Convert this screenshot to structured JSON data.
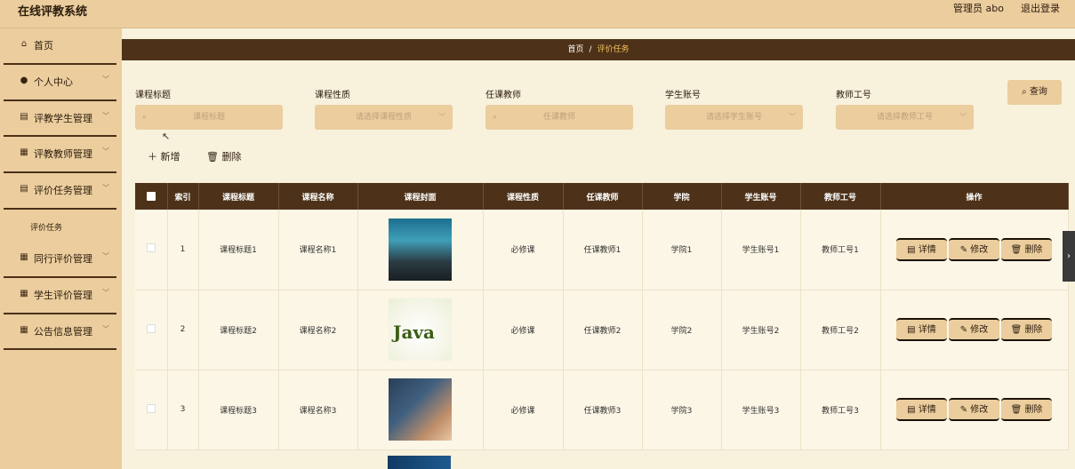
{
  "header": {
    "title": "在线评教系统",
    "user": "管理员 abo",
    "logout": "退出登录"
  },
  "sidebar": {
    "items": [
      {
        "label": "首页",
        "icon": "home-icon",
        "glyph": "⌂",
        "chevron": false
      },
      {
        "label": "个人中心",
        "icon": "user-icon",
        "glyph": "●",
        "chevron": true
      },
      {
        "label": "评教学生管理",
        "icon": "grid-icon",
        "glyph": "▤",
        "chevron": true
      },
      {
        "label": "评教教师管理",
        "icon": "apps-icon",
        "glyph": "▦",
        "chevron": true
      },
      {
        "label": "评价任务管理",
        "icon": "document-icon",
        "glyph": "▤",
        "chevron": true
      }
    ],
    "subitem": "评价任务",
    "items2": [
      {
        "label": "同行评价管理",
        "icon": "grid-icon",
        "glyph": "▦",
        "chevron": true
      },
      {
        "label": "学生评价管理",
        "icon": "apps-icon",
        "glyph": "▦",
        "chevron": true
      },
      {
        "label": "公告信息管理",
        "icon": "apps-icon",
        "glyph": "▦",
        "chevron": true
      }
    ]
  },
  "breadcrumb": {
    "home": "首页",
    "sep": "/",
    "current": "评价任务"
  },
  "search": {
    "fields": [
      {
        "label": "课程标题",
        "placeholder": "课程标题"
      },
      {
        "label": "课程性质",
        "placeholder": "请选择课程性质"
      },
      {
        "label": "任课教师",
        "placeholder": "任课教师"
      },
      {
        "label": "学生账号",
        "placeholder": "请选择学生账号"
      },
      {
        "label": "教师工号",
        "placeholder": "请选择教师工号"
      }
    ],
    "query": "查询"
  },
  "actions": {
    "add": "新增",
    "delete": "删除"
  },
  "table": {
    "headers": [
      "索引",
      "课程标题",
      "课程名称",
      "课程封面",
      "课程性质",
      "任课教师",
      "学院",
      "学生账号",
      "教师工号",
      "操作"
    ],
    "rows": [
      {
        "index": "1",
        "title": "课程标题1",
        "name": "课程名称1",
        "nature": "必修课",
        "teacher": "任课教师1",
        "college": "学院1",
        "student": "学生账号1",
        "tno": "教师工号1"
      },
      {
        "index": "2",
        "title": "课程标题2",
        "name": "课程名称2",
        "nature": "必修课",
        "teacher": "任课教师2",
        "college": "学院2",
        "student": "学生账号2",
        "tno": "教师工号2"
      },
      {
        "index": "3",
        "title": "课程标题3",
        "name": "课程名称3",
        "nature": "必修课",
        "teacher": "任课教师3",
        "college": "学院3",
        "student": "学生账号3",
        "tno": "教师工号3"
      }
    ],
    "ops": {
      "detail": "详情",
      "edit": "修改",
      "delete": "删除"
    },
    "cover2_text": "Java"
  }
}
